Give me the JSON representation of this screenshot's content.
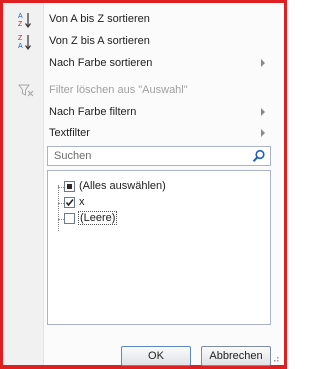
{
  "menu": {
    "items": [
      {
        "label": "Von A bis Z sortieren",
        "icon": "sort-a-to-z-icon",
        "disabled": false,
        "submenu": false
      },
      {
        "label": "Von Z bis A sortieren",
        "icon": "sort-z-to-a-icon",
        "disabled": false,
        "submenu": false
      },
      {
        "label": "Nach Farbe sortieren",
        "icon": "",
        "disabled": false,
        "submenu": true
      },
      {
        "label": "Filter löschen aus \"Auswahl\"",
        "icon": "clear-filter-icon",
        "disabled": true,
        "submenu": false
      },
      {
        "label": "Nach Farbe filtern",
        "icon": "",
        "disabled": false,
        "submenu": true
      },
      {
        "label": "Textfilter",
        "icon": "",
        "disabled": false,
        "submenu": true
      }
    ]
  },
  "search": {
    "placeholder": "Suchen",
    "icon": "search-icon"
  },
  "values": {
    "items": [
      {
        "label": "(Alles auswählen)",
        "state": "indeterminate"
      },
      {
        "label": "x",
        "state": "checked"
      },
      {
        "label": "(Leere)",
        "state": "unchecked"
      }
    ]
  },
  "buttons": {
    "ok_label": "OK",
    "cancel_label": "Abbrechen"
  },
  "colors": {
    "highlight_border": "#e02020",
    "gutter": "#f1f1f1",
    "disabled_text": "#a0a0a0"
  }
}
